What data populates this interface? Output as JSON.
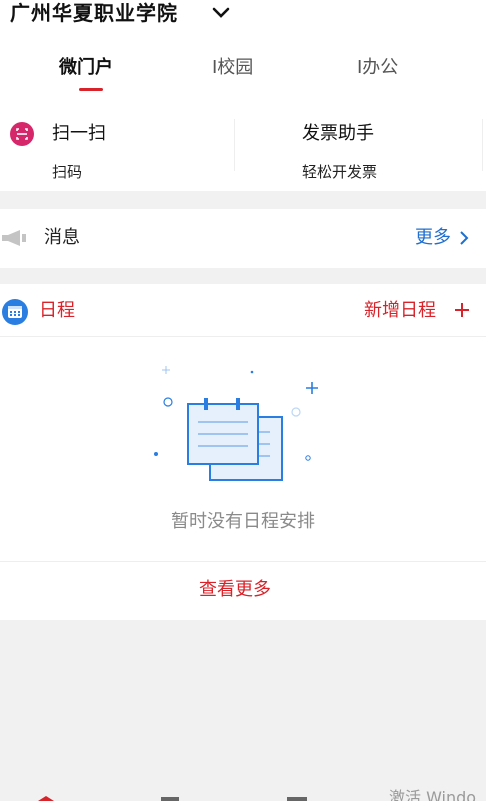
{
  "header": {
    "school_name": "广州华夏职业学院"
  },
  "tabs": [
    {
      "label": "微门户",
      "active": true
    },
    {
      "label": "I校园",
      "active": false
    },
    {
      "label": "I办公",
      "active": false
    }
  ],
  "quick_actions": [
    {
      "title": "扫一扫",
      "subtitle": "扫码",
      "icon": "scan-icon"
    },
    {
      "title": "发票助手",
      "subtitle": "轻松开发票"
    }
  ],
  "messages": {
    "label": "消息",
    "more": "更多",
    "icon": "megaphone-icon"
  },
  "schedule": {
    "title": "日程",
    "add_label": "新增日程",
    "empty_text": "暂时没有日程安排",
    "view_more": "查看更多",
    "icon": "calendar-icon"
  },
  "watermark": "激活 Windo",
  "colors": {
    "accent_red": "#d8232a",
    "link_blue": "#1f6fcf",
    "scan_pink": "#d6276b"
  }
}
